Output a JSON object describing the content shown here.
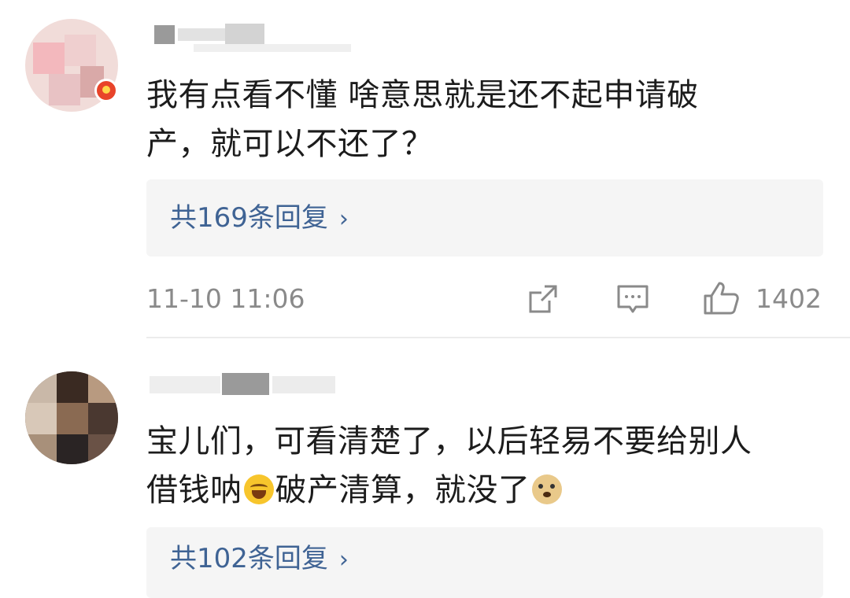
{
  "comments": [
    {
      "text_line1": "我有点看不懂 啥意思就是还不起申请破",
      "text_line2": "产，就可以不还了？",
      "replies_label": "共169条回复",
      "reply_chevron": "›",
      "time": "11-10 11:06",
      "like_count": "1402"
    },
    {
      "text_line1": "宝儿们，可看清楚了，以后轻易不要给别人",
      "text_line2a": "借钱呐",
      "text_line2b": "破产清算，就没了",
      "replies_label": "共102条回复",
      "reply_chevron": "›"
    }
  ],
  "icons": {
    "share": "share-icon",
    "comment": "comment-icon",
    "like": "thumbs-up-icon"
  },
  "colors": {
    "reply_link": "#3f6394",
    "meta_gray": "#8a8a8a",
    "reply_bg": "#f5f5f5"
  }
}
